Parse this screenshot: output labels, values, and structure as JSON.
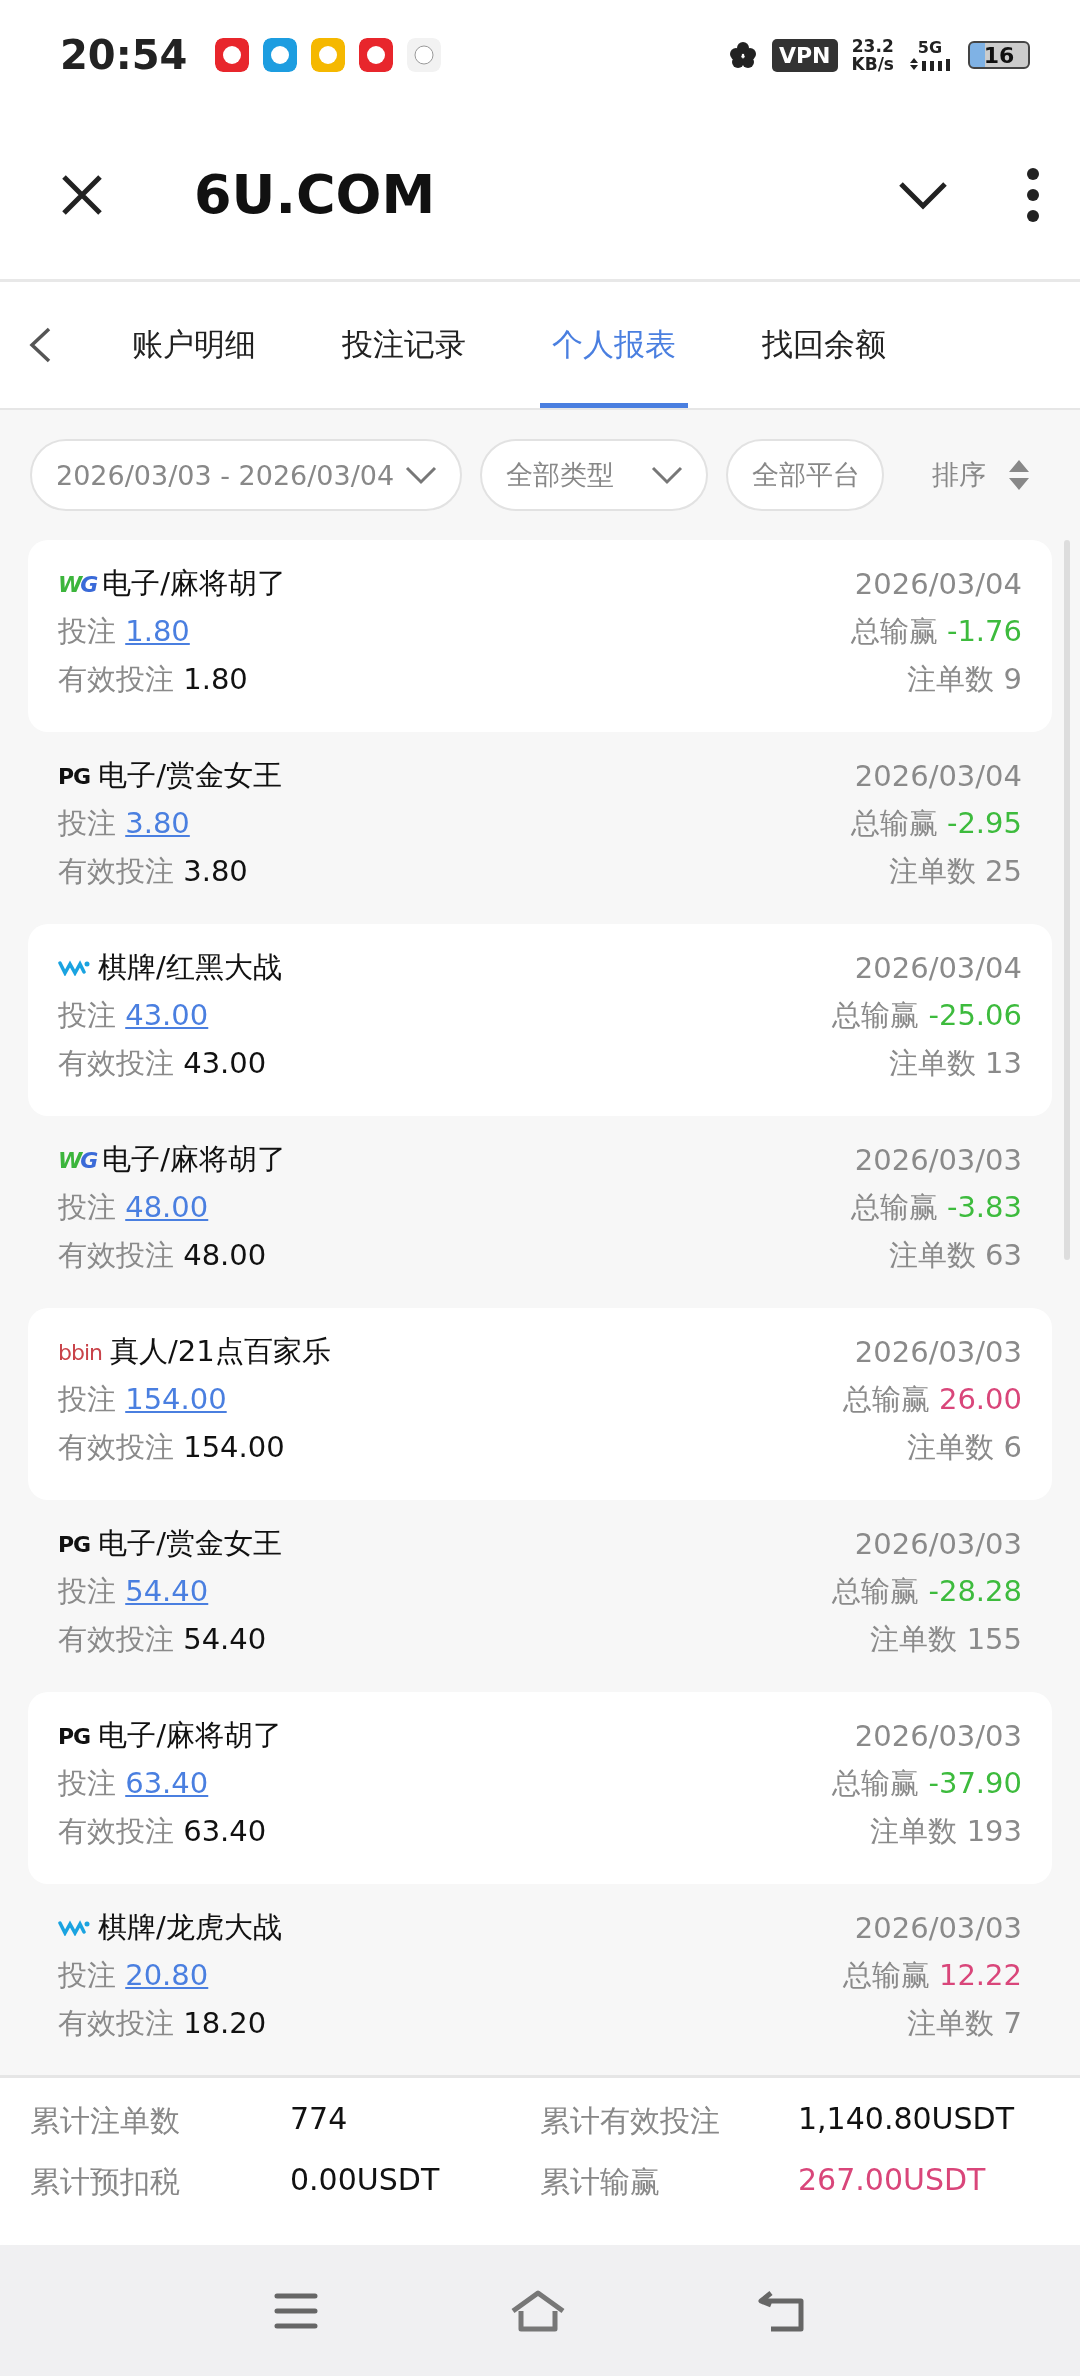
{
  "status_bar": {
    "time": "20:54",
    "vpn": "VPN",
    "speed": "23.2",
    "speed_unit": "KB/s",
    "network": "5G",
    "battery": "16"
  },
  "header": {
    "title": "6U.COM"
  },
  "tabs": [
    {
      "label": "账户明细",
      "selected": false
    },
    {
      "label": "投注记录",
      "selected": false
    },
    {
      "label": "个人报表",
      "selected": true
    },
    {
      "label": "找回余额",
      "selected": false
    }
  ],
  "filters": [
    {
      "label": "2026/03/03 - 2026/03/04"
    },
    {
      "label": "全部类型"
    },
    {
      "label": "全部平台"
    }
  ],
  "sort": {
    "label": "排序"
  },
  "records": [
    {
      "logo": {
        "kind": "wg",
        "text": "WG"
      },
      "game": "电子/麻将胡了",
      "date": "2026/03/04",
      "bet_label": "投注",
      "bet": "1.80",
      "valid_label": "有效投注",
      "valid": "1.80",
      "winloss_label": "总输赢",
      "winloss": "-1.76",
      "color": "#3dbb3d",
      "count_label": "注单数",
      "count": "9"
    },
    {
      "logo": {
        "kind": "pg",
        "text": "PG"
      },
      "game": "电子/赏金女王",
      "date": "2026/03/04",
      "bet_label": "投注",
      "bet": "3.80",
      "valid_label": "有效投注",
      "valid": "3.80",
      "winloss_label": "总输赢",
      "winloss": "-2.95",
      "color": "#3dbb3d",
      "count_label": "注单数",
      "count": "25"
    },
    {
      "logo": {
        "kind": "wave"
      },
      "game": "棋牌/红黑大战",
      "date": "2026/03/04",
      "bet_label": "投注",
      "bet": "43.00",
      "valid_label": "有效投注",
      "valid": "43.00",
      "winloss_label": "总输赢",
      "winloss": "-25.06",
      "color": "#3dbb3d",
      "count_label": "注单数",
      "count": "13"
    },
    {
      "logo": {
        "kind": "wg",
        "text": "WG"
      },
      "game": "电子/麻将胡了",
      "date": "2026/03/03",
      "bet_label": "投注",
      "bet": "48.00",
      "valid_label": "有效投注",
      "valid": "48.00",
      "winloss_label": "总输赢",
      "winloss": "-3.83",
      "color": "#3dbb3d",
      "count_label": "注单数",
      "count": "63"
    },
    {
      "logo": {
        "kind": "bbin",
        "text": "bbin"
      },
      "game": "真人/21点百家乐",
      "date": "2026/03/03",
      "bet_label": "投注",
      "bet": "154.00",
      "valid_label": "有效投注",
      "valid": "154.00",
      "winloss_label": "总输赢",
      "winloss": "26.00",
      "color": "#d9467a",
      "count_label": "注单数",
      "count": "6"
    },
    {
      "logo": {
        "kind": "pg",
        "text": "PG"
      },
      "game": "电子/赏金女王",
      "date": "2026/03/03",
      "bet_label": "投注",
      "bet": "54.40",
      "valid_label": "有效投注",
      "valid": "54.40",
      "winloss_label": "总输赢",
      "winloss": "-28.28",
      "color": "#3dbb3d",
      "count_label": "注单数",
      "count": "155"
    },
    {
      "logo": {
        "kind": "pg",
        "text": "PG"
      },
      "game": "电子/麻将胡了",
      "date": "2026/03/03",
      "bet_label": "投注",
      "bet": "63.40",
      "valid_label": "有效投注",
      "valid": "63.40",
      "winloss_label": "总输赢",
      "winloss": "-37.90",
      "color": "#3dbb3d",
      "count_label": "注单数",
      "count": "193"
    },
    {
      "logo": {
        "kind": "wave"
      },
      "game": "棋牌/龙虎大战",
      "date": "2026/03/03",
      "bet_label": "投注",
      "bet": "20.80",
      "valid_label": "有效投注",
      "valid": "18.20",
      "winloss_label": "总输赢",
      "winloss": "12.22",
      "color": "#d9467a",
      "count_label": "注单数",
      "count": "7"
    }
  ],
  "summary": [
    {
      "label": "累计注单数",
      "value": "774"
    },
    {
      "label": "累计有效投注",
      "value": "1,140.80USDT"
    },
    {
      "label": "累计预扣税",
      "value": "0.00USDT"
    },
    {
      "label": "累计输赢",
      "value": "267.00USDT",
      "color": "#d9467a"
    }
  ]
}
